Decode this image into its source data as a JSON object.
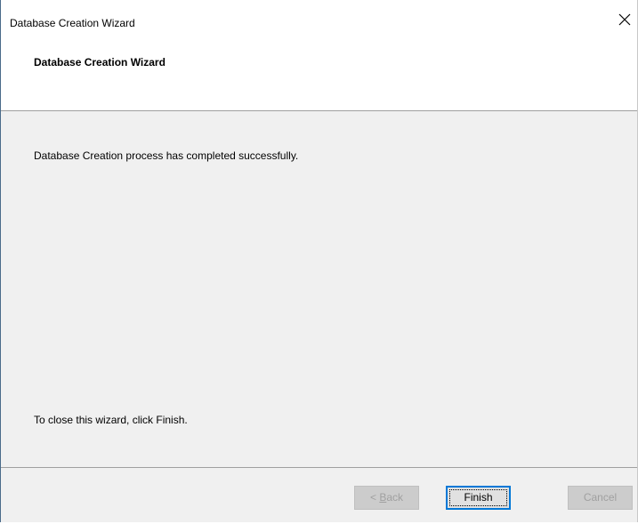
{
  "window": {
    "title": "Database Creation Wizard",
    "close_icon": "close-icon"
  },
  "header": {
    "title": "Database Creation Wizard"
  },
  "content": {
    "message": "Database Creation process has completed successfully.",
    "close_hint": "To close this wizard, click Finish."
  },
  "buttons": {
    "back_prefix": "< ",
    "back_mnemonic": "B",
    "back_rest": "ack",
    "finish_label": "Finish",
    "cancel_label": "Cancel"
  }
}
